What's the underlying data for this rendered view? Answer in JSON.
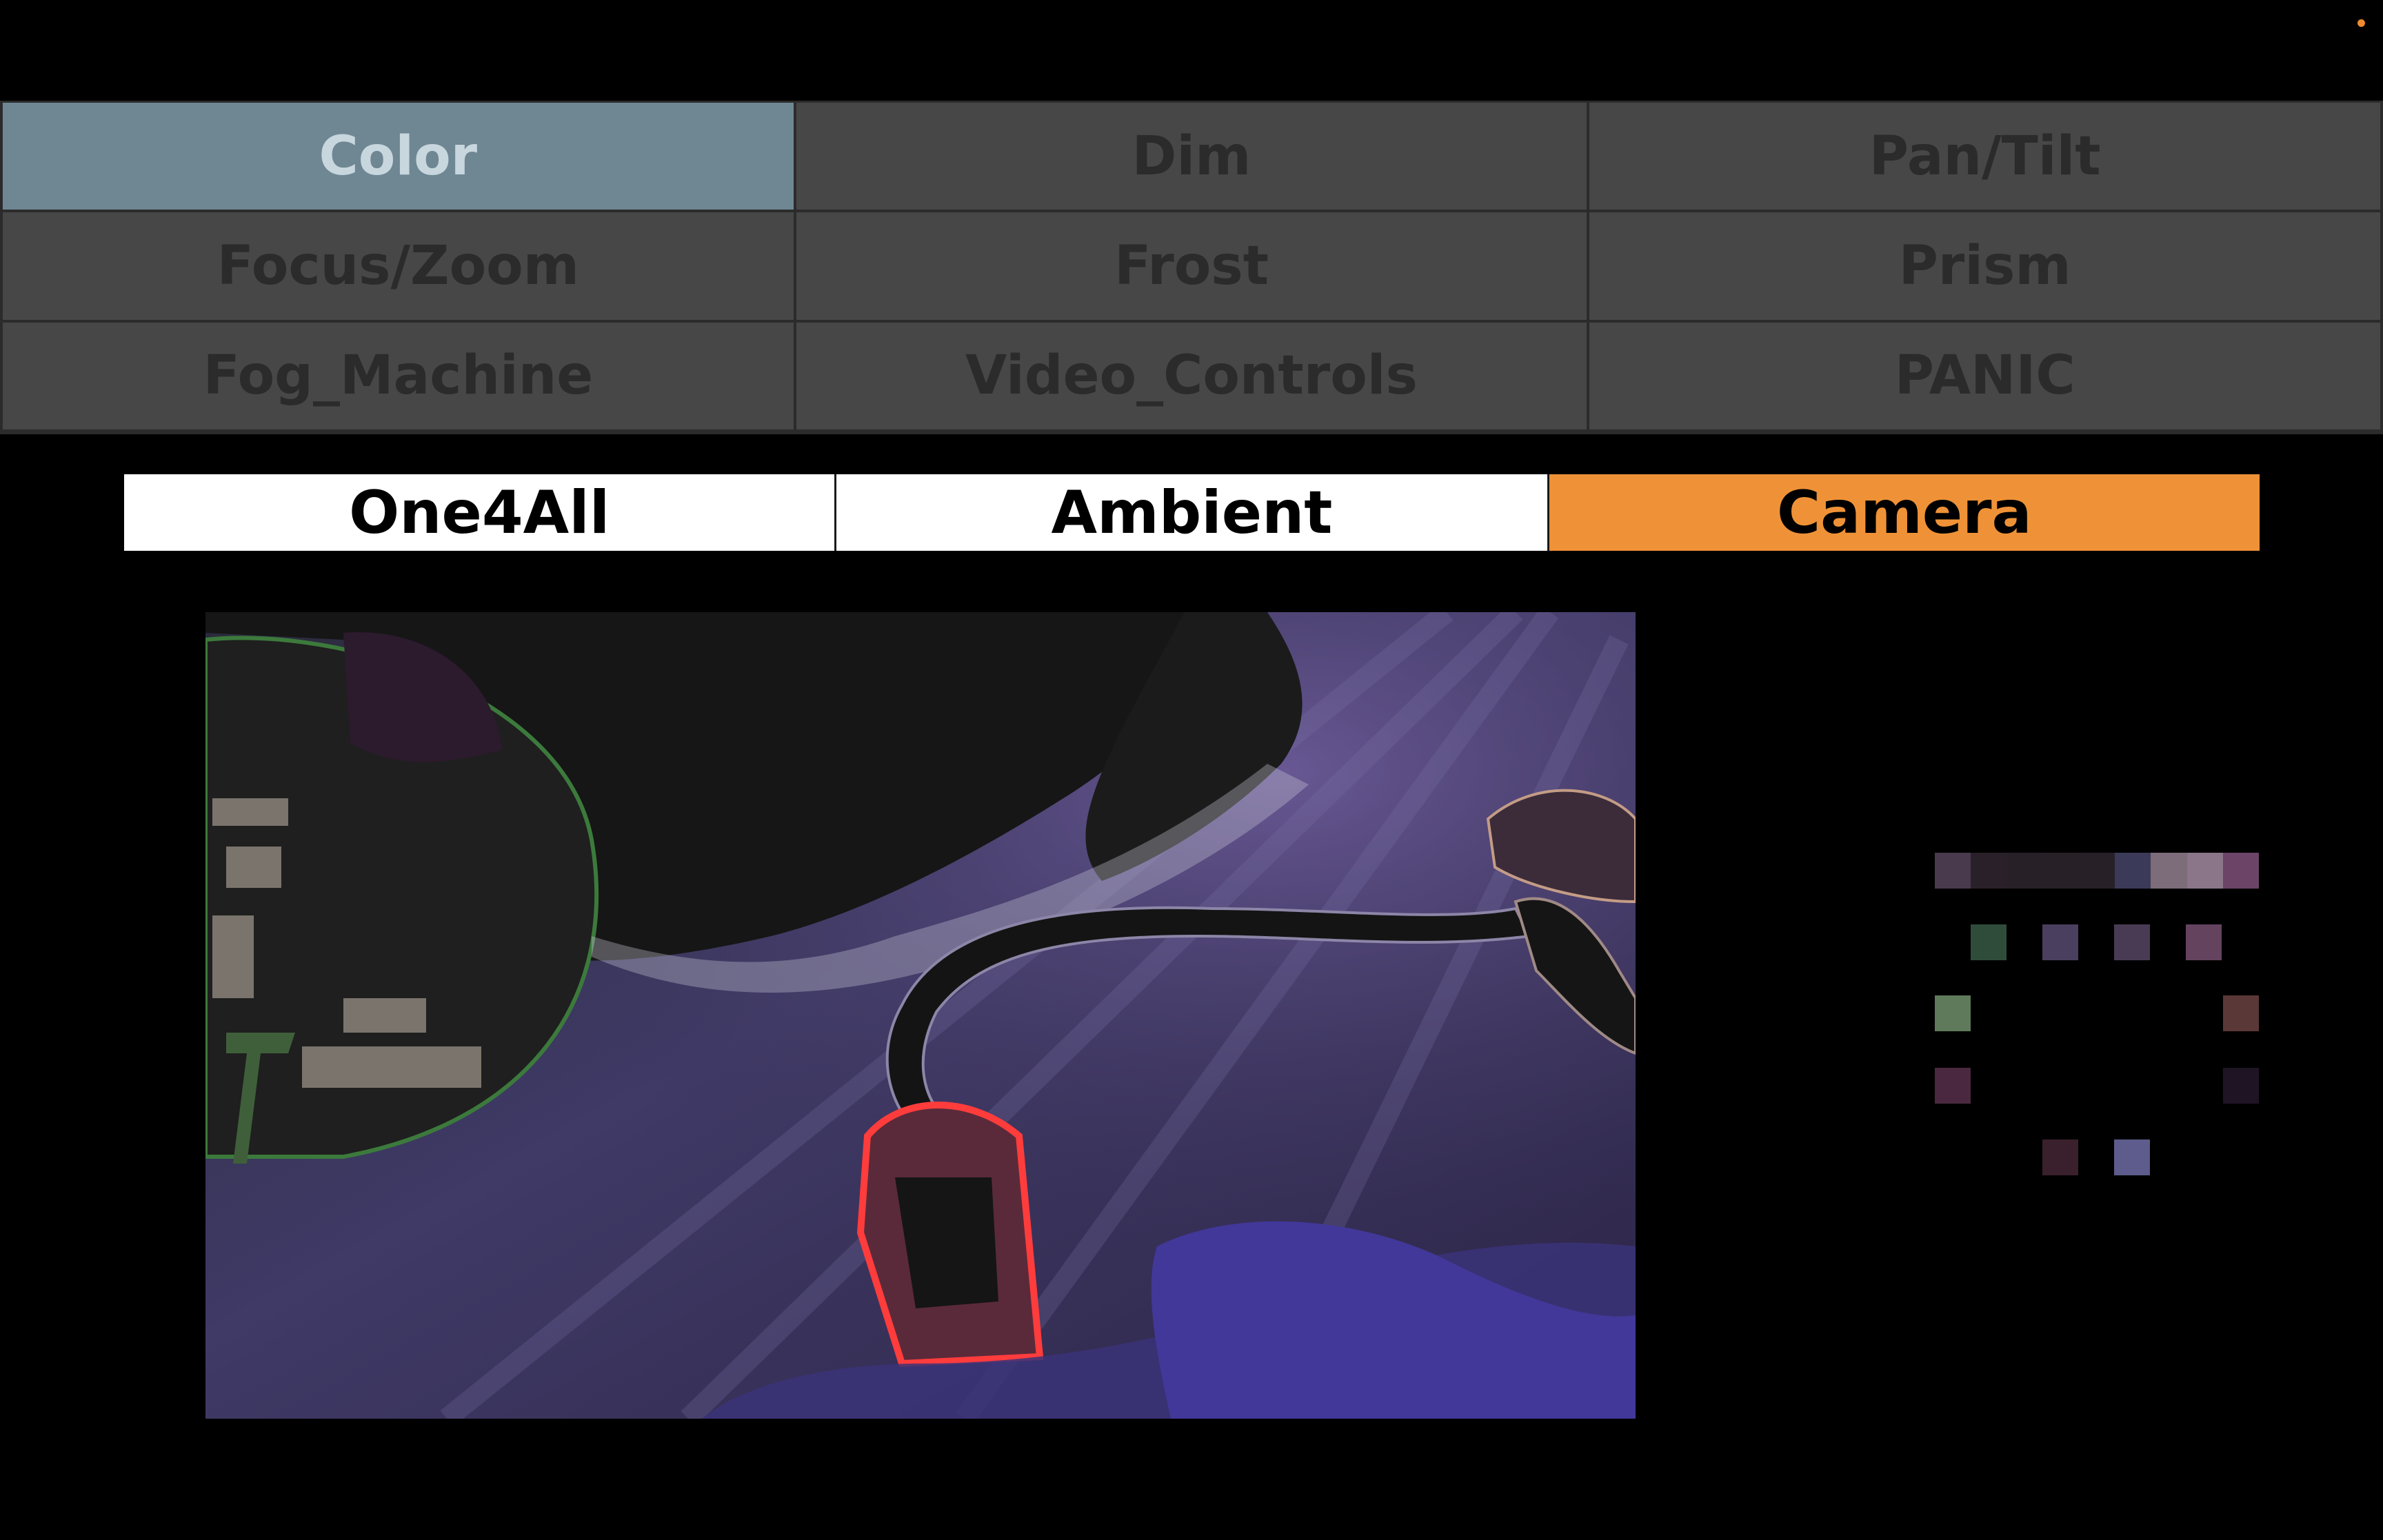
{
  "status_indicator": {
    "color": "#ef8b2f"
  },
  "fixture_groups": [
    {
      "label": "Color",
      "active": true
    },
    {
      "label": "Dim",
      "active": false
    },
    {
      "label": "Pan/Tilt",
      "active": false
    },
    {
      "label": "Focus/Zoom",
      "active": false
    },
    {
      "label": "Frost",
      "active": false
    },
    {
      "label": "Prism",
      "active": false
    },
    {
      "label": "Fog_Machine",
      "active": false
    },
    {
      "label": "Video_Controls",
      "active": false
    },
    {
      "label": "PANIC",
      "active": false
    }
  ],
  "mode_tabs": [
    {
      "label": "One4All",
      "active": false
    },
    {
      "label": "Ambient",
      "active": false
    },
    {
      "label": "Camera",
      "active": true
    }
  ],
  "camera_feed": {
    "icon": "camera-feed-image"
  },
  "color_swatches": {
    "strip": [
      "#4a3a4e",
      "#2a2029",
      "#272027",
      "#272127",
      "#272027",
      "#3c3a59",
      "#7d6c79",
      "#8a7589",
      "#6b4467"
    ],
    "ring": [
      "#2f4c3b",
      "#4b3f5f",
      "#4a3b55",
      "#64435f",
      "#5f7a5a",
      "#5a3837",
      "#4a2940",
      "#1f1424",
      "#3a202c",
      "#5d5c8c"
    ]
  },
  "colors": {
    "active_group": "#6e8793",
    "inactive_group": "#474747",
    "active_tab": "#ef9237",
    "inactive_tab": "#ffffff"
  }
}
